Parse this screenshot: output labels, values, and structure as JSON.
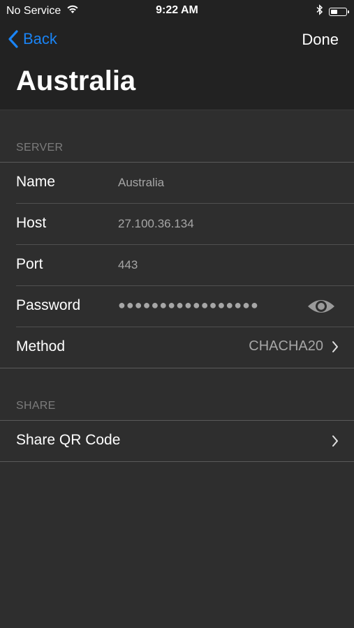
{
  "status_bar": {
    "carrier": "No Service",
    "time": "9:22 AM",
    "battery_level": 0.45
  },
  "nav": {
    "back_label": "Back",
    "done_label": "Done",
    "title": "Australia"
  },
  "server_section": {
    "header": "SERVER",
    "rows": [
      {
        "label": "Name",
        "value": "Australia"
      },
      {
        "label": "Host",
        "value": "27.100.36.134"
      },
      {
        "label": "Port",
        "value": "443"
      },
      {
        "label": "Password",
        "value": "●●●●●●●●●●●●●●●●●"
      },
      {
        "label": "Method",
        "value": "CHACHA20"
      }
    ]
  },
  "share_section": {
    "header": "SHARE",
    "rows": [
      {
        "label": "Share QR Code"
      }
    ]
  },
  "colors": {
    "accent": "#1a84f5",
    "background": "#2e2e2e",
    "bar": "#222222"
  }
}
